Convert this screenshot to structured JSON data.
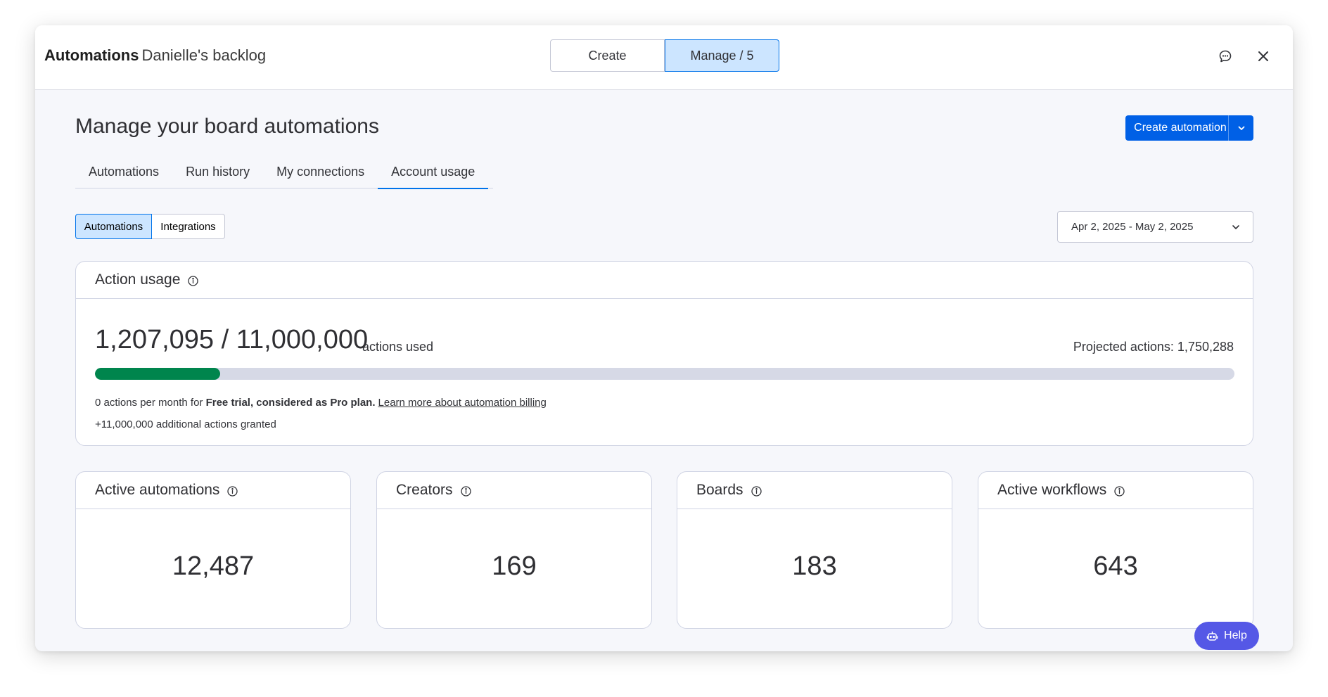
{
  "header": {
    "app_name": "Automations",
    "board_name": "Danielle's backlog",
    "create_label": "Create",
    "manage_label": "Manage / 5"
  },
  "page": {
    "title": "Manage your board automations",
    "create_button_label": "Create automation"
  },
  "tabs": [
    {
      "label": "Automations",
      "active": false
    },
    {
      "label": "Run history",
      "active": false
    },
    {
      "label": "My connections",
      "active": false
    },
    {
      "label": "Account usage",
      "active": true
    }
  ],
  "subtoggle": {
    "automations_label": "Automations",
    "integrations_label": "Integrations",
    "selected": "Automations"
  },
  "date_range": "Apr 2, 2025 - May 2, 2025",
  "action_usage": {
    "title": "Action usage",
    "used_display": "1,207,095 / 11,000,000",
    "used_value": 1207095,
    "limit_value": 11000000,
    "unit_label": "actions used",
    "projected": "Projected actions: 1,750,288",
    "note_prefix": "0 actions per month for ",
    "note_bold": "Free trial, considered as Pro plan.",
    "note_link": "Learn more about automation billing",
    "granted": "+11,000,000 additional actions granted"
  },
  "stats": [
    {
      "title": "Active automations",
      "value": "12,487"
    },
    {
      "title": "Creators",
      "value": "169"
    },
    {
      "title": "Boards",
      "value": "183"
    },
    {
      "title": "Active workflows",
      "value": "643"
    }
  ],
  "help_label": "Help",
  "colors": {
    "accent": "#0073ea",
    "primary_button": "#0060e6",
    "progress_fill": "#00854d",
    "progress_track": "#d6d9e6",
    "help_button": "#5558e6",
    "selected_bg": "#cce5ff"
  }
}
